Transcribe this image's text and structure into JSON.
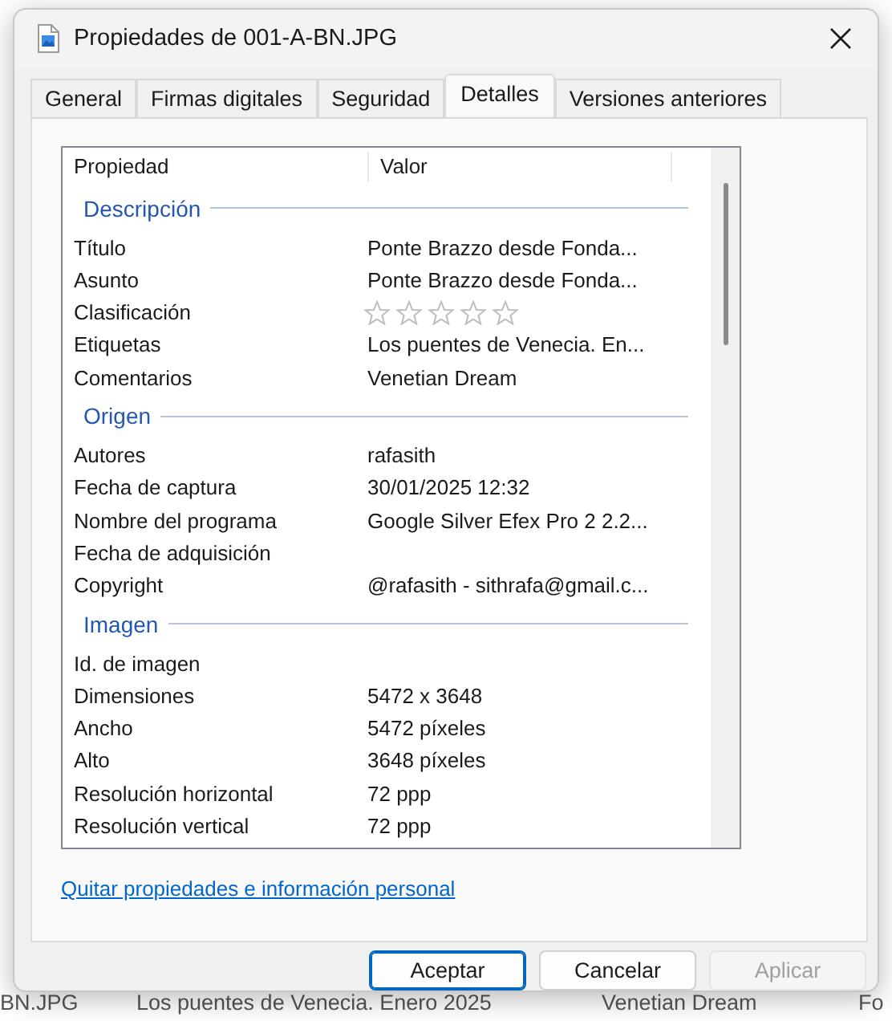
{
  "background_window": {
    "row": [
      "BN.JPG",
      "Los puentes de Venecia. Enero 2025",
      "Venetian Dream",
      "Fo"
    ]
  },
  "window": {
    "title": "Propiedades de 001-A-BN.JPG"
  },
  "tabs": [
    {
      "label": "General",
      "selected": false
    },
    {
      "label": "Firmas digitales",
      "selected": false
    },
    {
      "label": "Seguridad",
      "selected": false
    },
    {
      "label": "Detalles",
      "selected": true
    },
    {
      "label": "Versiones anteriores",
      "selected": false
    }
  ],
  "details": {
    "columns": [
      "Propiedad",
      "Valor"
    ],
    "groups": [
      {
        "title": "Descripción",
        "rows": [
          {
            "kind": "text",
            "property": "Título",
            "value": "Ponte Brazzo desde Fonda..."
          },
          {
            "kind": "text",
            "property": "Asunto",
            "value": "Ponte Brazzo desde Fonda..."
          },
          {
            "kind": "rating",
            "property": "Clasificación",
            "stars": 0
          },
          {
            "kind": "text",
            "property": "Etiquetas",
            "value": "Los puentes de Venecia. En..."
          },
          {
            "kind": "text",
            "property": "Comentarios",
            "value": "Venetian Dream"
          }
        ]
      },
      {
        "title": "Origen",
        "rows": [
          {
            "kind": "text",
            "property": "Autores",
            "value": "rafasith"
          },
          {
            "kind": "text",
            "property": "Fecha de captura",
            "value": "30/01/2025 12:32"
          },
          {
            "kind": "text",
            "property": "Nombre del programa",
            "value": "Google Silver Efex Pro 2 2.2..."
          },
          {
            "kind": "text",
            "property": "Fecha de adquisición"
          },
          {
            "kind": "text",
            "property": "Copyright",
            "value": "@rafasith - sithrafa@gmail.c..."
          }
        ]
      },
      {
        "title": "Imagen",
        "rows": [
          {
            "kind": "text",
            "property": "Id. de imagen"
          },
          {
            "kind": "text",
            "property": "Dimensiones",
            "value": "5472 x 3648"
          },
          {
            "kind": "text",
            "property": "Ancho",
            "value": "5472 píxeles"
          },
          {
            "kind": "text",
            "property": "Alto",
            "value": "3648 píxeles"
          },
          {
            "kind": "text",
            "property": "Resolución horizontal",
            "value": "72 ppp"
          },
          {
            "kind": "text",
            "property": "Resolución vertical",
            "value": "72 ppp"
          }
        ]
      }
    ]
  },
  "link": "Quitar propiedades e información personal",
  "buttons": [
    {
      "label": "Aceptar",
      "default": true,
      "disabled": false
    },
    {
      "label": "Cancelar",
      "default": false,
      "disabled": false
    },
    {
      "label": "Aplicar",
      "default": false,
      "disabled": true
    }
  ]
}
